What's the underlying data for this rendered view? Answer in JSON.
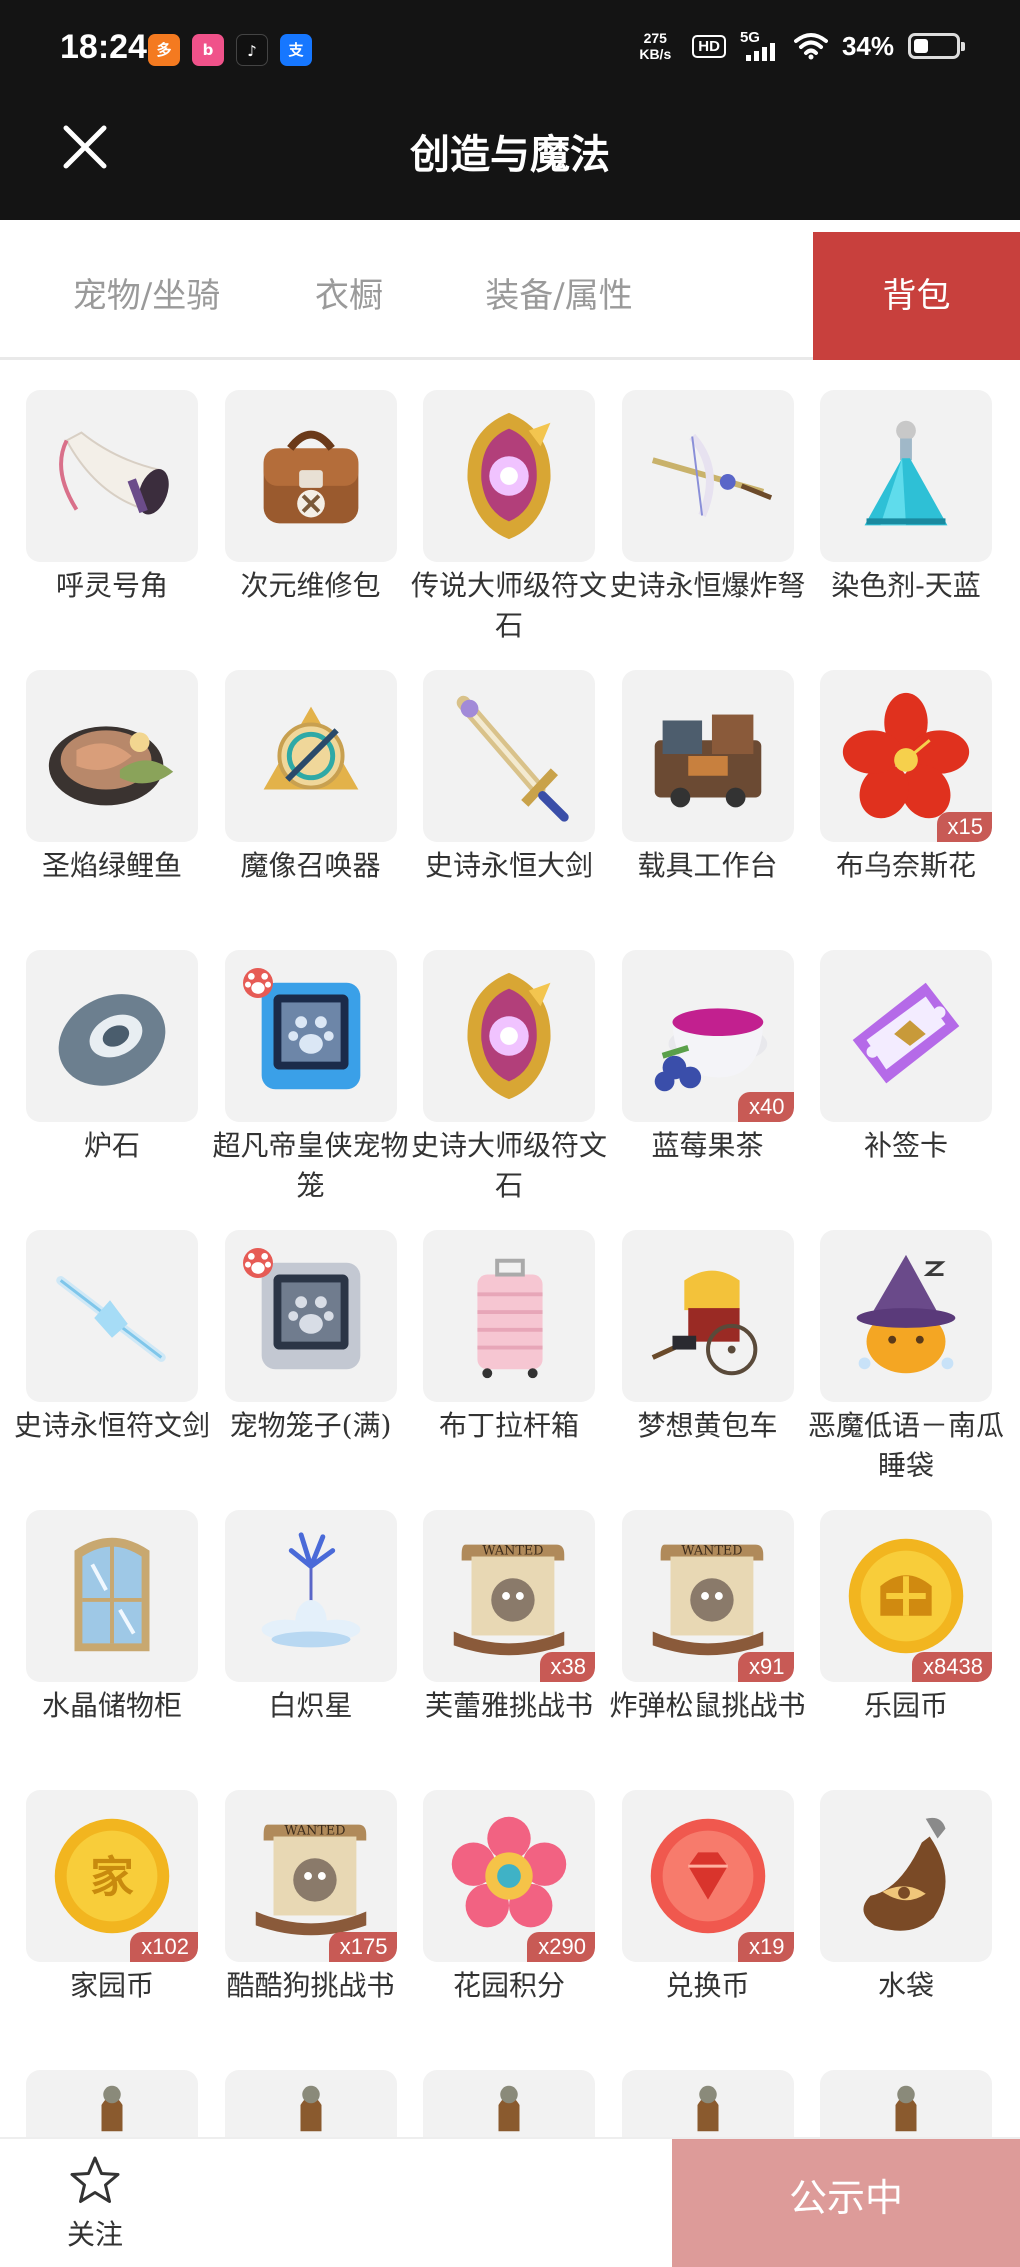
{
  "status_bar": {
    "time": "18:24",
    "net_speed_value": "275",
    "net_speed_unit": "KB/s",
    "hd": "HD",
    "signal": "5G",
    "battery_pct": "34%",
    "battery_level": 0.34
  },
  "header": {
    "title": "创造与魔法"
  },
  "tabs": [
    {
      "label": "宠物/坐骑",
      "active": false
    },
    {
      "label": "衣橱",
      "active": false
    },
    {
      "label": "装备/属性",
      "active": false
    },
    {
      "label": "背包",
      "active": true
    }
  ],
  "items": [
    {
      "name": "呼灵号角",
      "count": "",
      "icon": "horn-icon"
    },
    {
      "name": "次元维修包",
      "count": "",
      "icon": "repair-bag-icon"
    },
    {
      "name": "传说大师级符文石",
      "count": "",
      "icon": "gold-rune-icon"
    },
    {
      "name": "史诗永恒爆炸弩",
      "count": "",
      "icon": "crossbow-icon"
    },
    {
      "name": "染色剂-天蓝",
      "count": "",
      "icon": "dye-bottle-icon"
    },
    {
      "name": "圣焰绿鲤鱼",
      "count": "",
      "icon": "fish-plate-icon"
    },
    {
      "name": "魔像召唤器",
      "count": "",
      "icon": "golem-summoner-icon"
    },
    {
      "name": "史诗永恒大剑",
      "count": "",
      "icon": "greatsword-icon"
    },
    {
      "name": "载具工作台",
      "count": "",
      "icon": "workbench-icon"
    },
    {
      "name": "布乌奈斯花",
      "count": "x15",
      "icon": "red-flower-icon"
    },
    {
      "name": "炉石",
      "count": "",
      "icon": "hearthstone-icon"
    },
    {
      "name": "超凡帝皇侠宠物笼",
      "count": "",
      "icon": "pet-cage-blue-icon",
      "paw": true
    },
    {
      "name": "史诗大师级符文石",
      "count": "",
      "icon": "gold-rune-icon"
    },
    {
      "name": "蓝莓果茶",
      "count": "x40",
      "icon": "tea-cup-icon"
    },
    {
      "name": "补签卡",
      "count": "",
      "icon": "ticket-icon"
    },
    {
      "name": "史诗永恒符文剑",
      "count": "",
      "icon": "crystal-sword-icon"
    },
    {
      "name": "宠物笼子(满)",
      "count": "",
      "icon": "pet-cage-grey-icon",
      "paw": true
    },
    {
      "name": "布丁拉杆箱",
      "count": "",
      "icon": "suitcase-icon"
    },
    {
      "name": "梦想黄包车",
      "count": "",
      "icon": "rickshaw-icon"
    },
    {
      "name": "恶魔低语－南瓜睡袋",
      "count": "",
      "icon": "pumpkin-icon"
    },
    {
      "name": "水晶储物柜",
      "count": "",
      "icon": "crystal-cabinet-icon"
    },
    {
      "name": "白炽星",
      "count": "",
      "icon": "white-flower-icon"
    },
    {
      "name": "芙蕾雅挑战书",
      "count": "x38",
      "icon": "wanted-scroll-icon"
    },
    {
      "name": "炸弹松鼠挑战书",
      "count": "x91",
      "icon": "wanted-scroll-icon"
    },
    {
      "name": "乐园币",
      "count": "x8438",
      "icon": "gold-coin-icon"
    },
    {
      "name": "家园币",
      "count": "x102",
      "icon": "home-coin-icon"
    },
    {
      "name": "酷酷狗挑战书",
      "count": "x175",
      "icon": "wanted-scroll-icon"
    },
    {
      "name": "花园积分",
      "count": "x290",
      "icon": "flower-badge-icon"
    },
    {
      "name": "兑换币",
      "count": "x19",
      "icon": "red-coin-icon"
    },
    {
      "name": "水袋",
      "count": "",
      "icon": "water-bag-icon"
    }
  ],
  "bottom_bar": {
    "follow_label": "关注",
    "notice_label": "公示中"
  },
  "colors": {
    "accent": "#c8403d",
    "notice_bg": "#dd9b99",
    "badge_bg": "#c85a55",
    "header_bg": "#141414"
  }
}
